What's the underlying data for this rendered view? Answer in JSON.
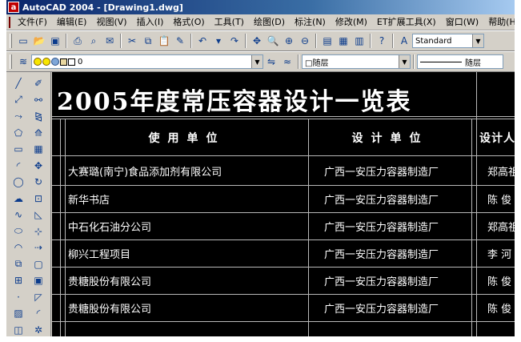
{
  "window": {
    "title": "AutoCAD 2004 - [Drawing1.dwg]",
    "icon_letter": "a"
  },
  "menu": [
    "文件(F)",
    "编辑(E)",
    "视图(V)",
    "插入(I)",
    "格式(O)",
    "工具(T)",
    "绘图(D)",
    "标注(N)",
    "修改(M)",
    "ET扩展工具(X)",
    "窗口(W)",
    "帮助(H)"
  ],
  "toolbar": {
    "text_style": "Standard"
  },
  "properties": {
    "layer_name": "0",
    "color": "□随层",
    "linetype": "随层"
  },
  "colors": {
    "canvas": "#000000",
    "title_bar": "#0a246a",
    "grid_line": "#b8b8b8"
  },
  "drawing": {
    "title": "2005年度常压容器设计一览表",
    "headers": [
      "使用单位",
      "设计单位",
      "设计人"
    ],
    "rows": [
      [
        "大赛璐(南宁)食品添加剂有限公司",
        "广西一安压力容器制造厂",
        "郑高祖"
      ],
      [
        "新华书店",
        "广西一安压力容器制造厂",
        "陈 俊"
      ],
      [
        "中石化石油分公司",
        "广西一安压力容器制造厂",
        "郑高祖"
      ],
      [
        "柳兴工程项目",
        "广西一安压力容器制造厂",
        "李 河"
      ],
      [
        "贵糖股份有限公司",
        "广西一安压力容器制造厂",
        "陈 俊"
      ],
      [
        "贵糖股份有限公司",
        "广西一安压力容器制造厂",
        "陈 俊"
      ]
    ]
  }
}
